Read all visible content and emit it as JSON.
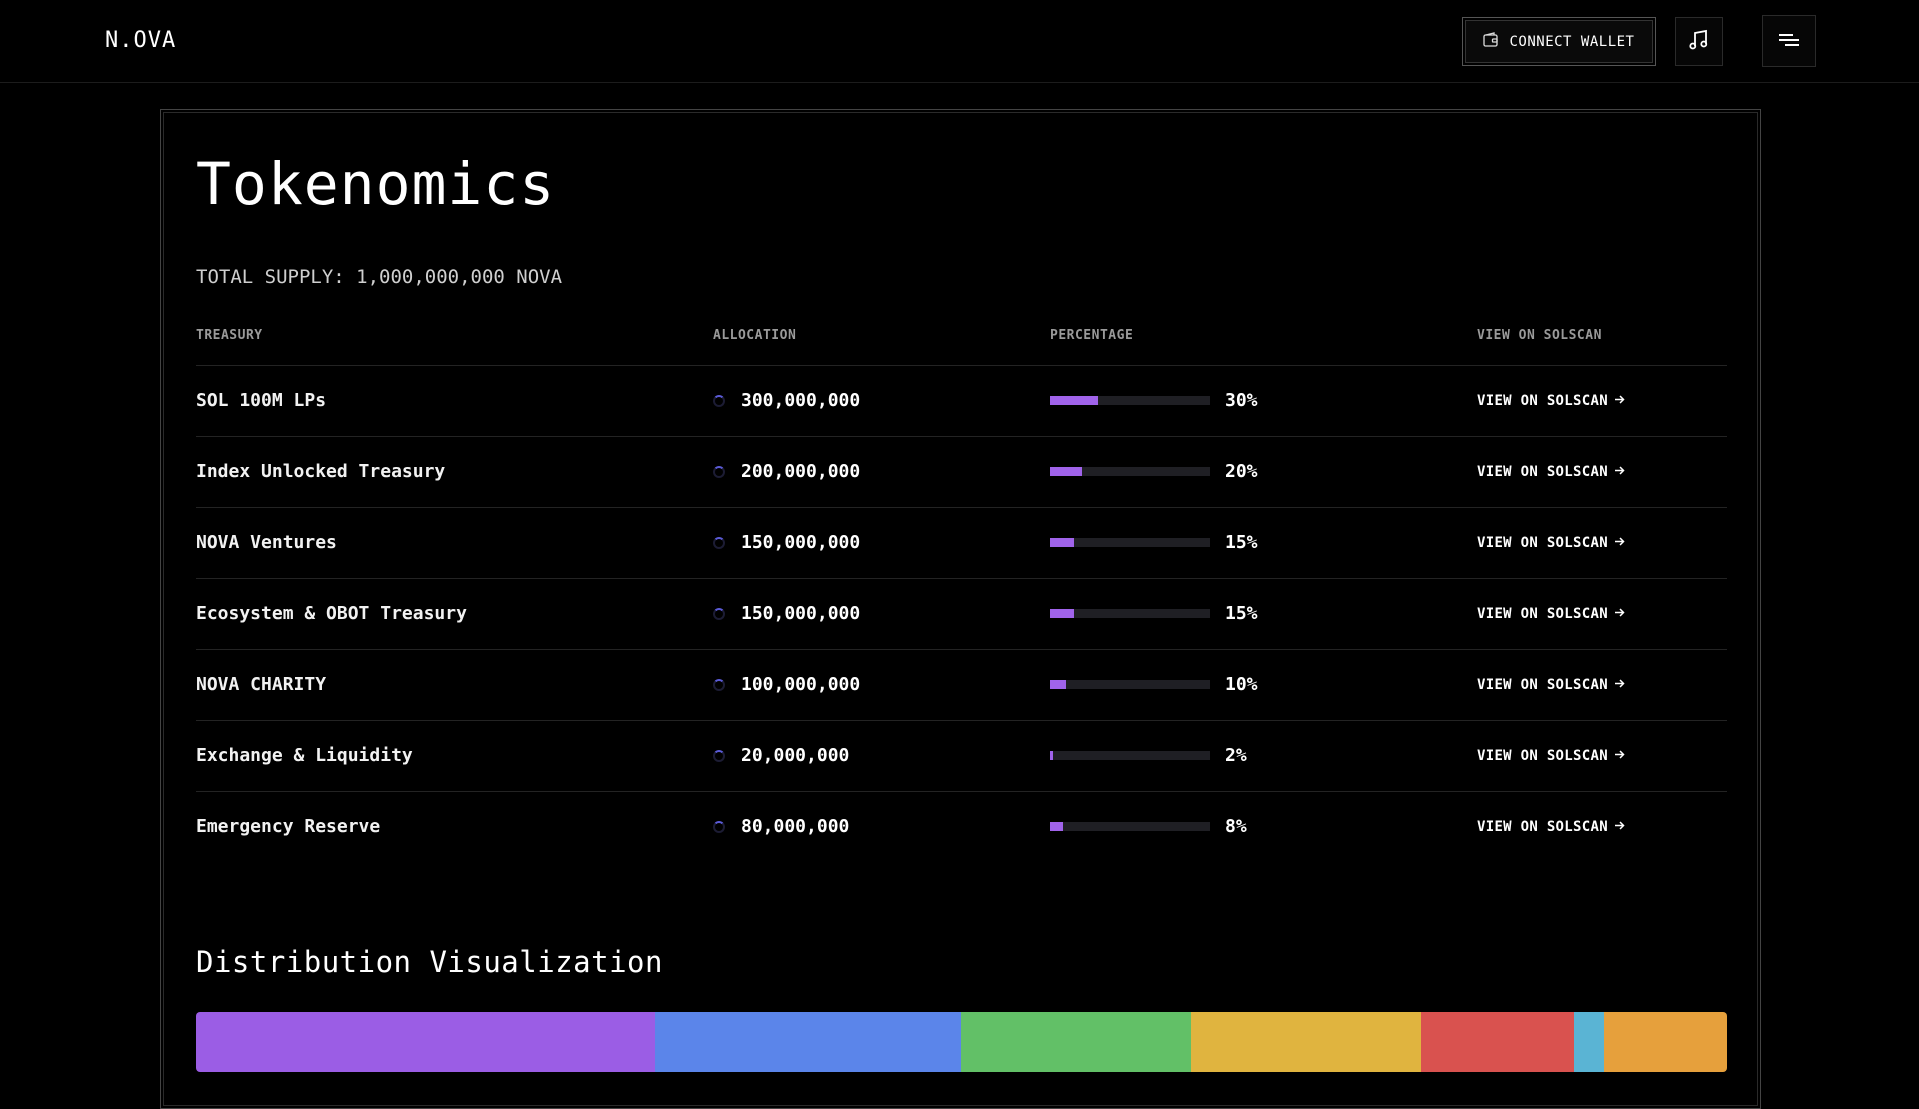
{
  "header": {
    "logo": "N.OVA",
    "connect_wallet_label": "CONNECT WALLET"
  },
  "main": {
    "title": "Tokenomics",
    "total_supply": "TOTAL SUPPLY: 1,000,000,000 NOVA",
    "columns": [
      "TREASURY",
      "ALLOCATION",
      "PERCENTAGE",
      "VIEW ON SOLSCAN"
    ],
    "rows": [
      {
        "name": "SOL 100M LPs",
        "allocation": "300,000,000",
        "percentage": "30%",
        "pct_value": 30,
        "link": "VIEW ON SOLSCAN"
      },
      {
        "name": "Index Unlocked Treasury",
        "allocation": "200,000,000",
        "percentage": "20%",
        "pct_value": 20,
        "link": "VIEW ON SOLSCAN"
      },
      {
        "name": "NOVA Ventures",
        "allocation": "150,000,000",
        "percentage": "15%",
        "pct_value": 15,
        "link": "VIEW ON SOLSCAN"
      },
      {
        "name": "Ecosystem & OBOT Treasury",
        "allocation": "150,000,000",
        "percentage": "15%",
        "pct_value": 15,
        "link": "VIEW ON SOLSCAN"
      },
      {
        "name": "NOVA CHARITY",
        "allocation": "100,000,000",
        "percentage": "10%",
        "pct_value": 10,
        "link": "VIEW ON SOLSCAN"
      },
      {
        "name": "Exchange & Liquidity",
        "allocation": "20,000,000",
        "percentage": "2%",
        "pct_value": 2,
        "link": "VIEW ON SOLSCAN"
      },
      {
        "name": "Emergency Reserve",
        "allocation": "80,000,000",
        "percentage": "8%",
        "pct_value": 8,
        "link": "VIEW ON SOLSCAN"
      }
    ],
    "distribution_title": "Distribution Visualization",
    "distribution": [
      {
        "value": 30,
        "color": "#9b5de5"
      },
      {
        "value": 20,
        "color": "#5b85ea"
      },
      {
        "value": 15,
        "color": "#62c067"
      },
      {
        "value": 15,
        "color": "#e0b43f"
      },
      {
        "value": 10,
        "color": "#d9524f"
      },
      {
        "value": 2,
        "color": "#5ab4d4"
      },
      {
        "value": 8,
        "color": "#e6a03c"
      }
    ]
  },
  "colors": {
    "accent": "#a063ea",
    "bar_track": "#1f1f24"
  },
  "icons": {
    "wallet": "wallet-icon",
    "music": "music-note-icon",
    "menu": "menu-icon",
    "arrow": "arrow-right-icon"
  }
}
